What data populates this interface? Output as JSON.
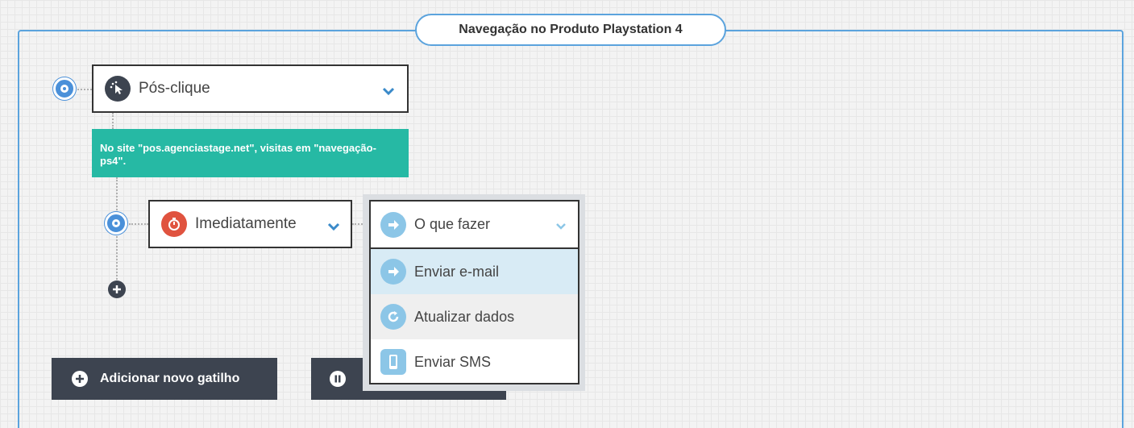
{
  "flow": {
    "title": "Navegação no Produto Playstation 4"
  },
  "trigger": {
    "label": "Pós-clique",
    "description": "No site \"pos.agenciastage.net\", visitas em \"navegação-ps4\"."
  },
  "timer": {
    "label": "Imediatamente"
  },
  "action": {
    "placeholder": "O que fazer",
    "options": [
      {
        "label": "Enviar e-mail",
        "icon": "arrow-right-icon"
      },
      {
        "label": "Atualizar dados",
        "icon": "refresh-icon"
      },
      {
        "label": "Enviar SMS",
        "icon": "phone-icon"
      }
    ]
  },
  "buttons": {
    "add_trigger": "Adicionar novo gatilho"
  },
  "colors": {
    "frame_blue": "#5ba3dd",
    "teal": "#26b9a4",
    "timer_red": "#e0533f",
    "action_icon": "#8cc6e7",
    "dark_button": "#3d4450"
  }
}
